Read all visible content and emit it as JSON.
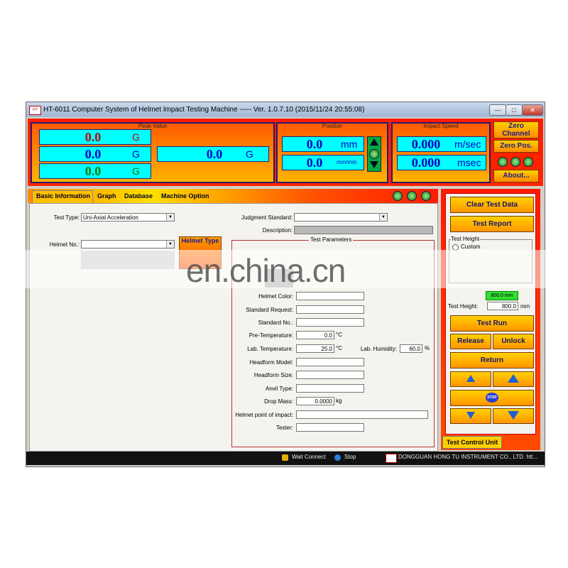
{
  "window": {
    "title": "HT-6011 Computer System of Helmet Impact Testing Machine ----- Ver. 1.0.7.10 (2015/11/24 20:55:08)",
    "controls": {
      "minimize": "—",
      "maximize": "□",
      "close": "✕"
    },
    "app_icon_text": "HT"
  },
  "peak_value": {
    "label": "Peak Value",
    "rows": [
      {
        "value": "0.0",
        "unit": "G",
        "color": "#c00000"
      },
      {
        "value": "0.0",
        "unit": "G",
        "color": "#0000c0"
      },
      {
        "value": "0.0",
        "unit": "G",
        "color": "#007a00"
      }
    ],
    "combined": {
      "value": "0.0",
      "unit": "G"
    }
  },
  "position": {
    "label": "Position",
    "rows": [
      {
        "value": "0.0",
        "unit": "mm"
      },
      {
        "value": "0.0",
        "unit": "mm/min"
      }
    ]
  },
  "impact_speed": {
    "label": "Impact Speed",
    "rows": [
      {
        "value": "0.000",
        "unit": "m/sec"
      },
      {
        "value": "0.000",
        "unit": "msec"
      }
    ]
  },
  "top_buttons": {
    "zero_channel": "Zero Channel",
    "zero_pos": "Zero Pos.",
    "about": "About..."
  },
  "tabs": [
    "Basic Information",
    "Graph",
    "Database",
    "Machine Option"
  ],
  "basic_info": {
    "test_type_label": "Test Type:",
    "test_type_value": "Uni-Axial Acceleration",
    "judgment_standard_label": "Judgment Standard:",
    "judgment_standard_value": "",
    "description_label": "Description:",
    "helmet_no_label": "Helmet No.:",
    "helmet_no_value": "",
    "helmet_type_button": "Helmet Type"
  },
  "test_parameters": {
    "title": "Test Parameters",
    "helmet_color_label": "Helmet Color:",
    "standard_request_label": "Standard Request:",
    "standard_no_label": "Standard No.:",
    "pre_temperature_label": "Pre-Temperature:",
    "pre_temperature_value": "0.0",
    "lab_temperature_label": "Lab. Temperature:",
    "lab_temperature_value": "25.0",
    "temp_unit": "°C",
    "lab_humidity_label": "Lab. Humidity:",
    "lab_humidity_value": "60.0",
    "humidity_unit": "%",
    "headform_model_label": "Headform Model:",
    "headform_size_label": "Headform Size:",
    "anvil_type_label": "Anvil Type:",
    "drop_mass_label": "Drop Mass:",
    "drop_mass_value": "0.0000",
    "drop_mass_unit": "kg",
    "impact_point_label": "Helmet point of impact:",
    "tester_label": "Tester:"
  },
  "control_unit": {
    "clear_test_data": "Clear Test Data",
    "test_report": "Test Report",
    "test_height_group": "Test Height",
    "custom_option": "Custom",
    "height_indicator": "800.0 mm",
    "test_height_label": "Test Height:",
    "test_height_value": "800.0",
    "test_height_unit": "mm",
    "test_run": "Test Run",
    "release": "Release",
    "unlock": "Unlock",
    "return": "Return",
    "stop": "STOP",
    "tab_label": "Test Control Unit"
  },
  "status_bar": {
    "wait_connect": "Wait Connect",
    "stop": "Stop",
    "company": "DONGGUAN HONG TU INSTRUMENT CO., LTD. htt..."
  },
  "watermark": "en.china.cn",
  "colors": {
    "panel_red": "#ff1a00",
    "button_orange": "#ffb000",
    "display_cyan": "#00ffff",
    "height_indicator": "#33dd33"
  }
}
